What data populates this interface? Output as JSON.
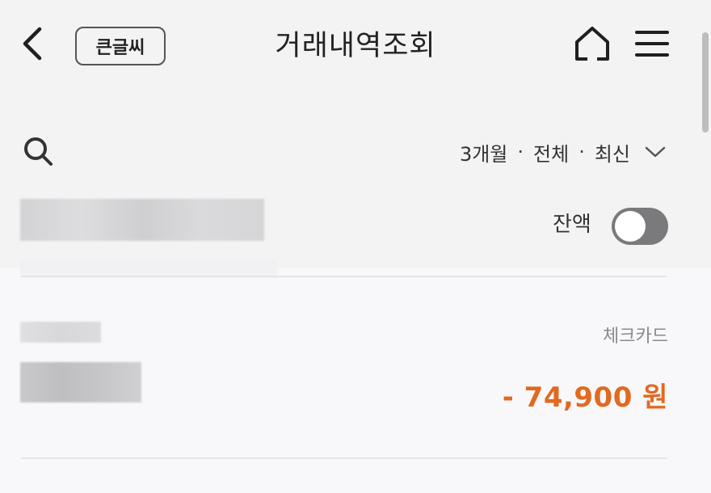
{
  "header": {
    "title": "거래내역조회",
    "bigfont_label": "큰글씨",
    "back_icon": "chevron-left-icon",
    "home_icon": "home-icon",
    "menu_icon": "hamburger-menu-icon"
  },
  "filter": {
    "search_icon": "search-icon",
    "period": "3개월",
    "type": "전체",
    "sort": "최신",
    "separator": "·",
    "dropdown_icon": "chevron-down-icon"
  },
  "balance": {
    "label": "잔액",
    "toggle_on": false
  },
  "transactions": [
    {
      "type": "체크카드",
      "amount": "- 74,900 원"
    }
  ],
  "colors": {
    "amount_negative": "#e2691f",
    "toggle_off": "#7a7a7c"
  }
}
